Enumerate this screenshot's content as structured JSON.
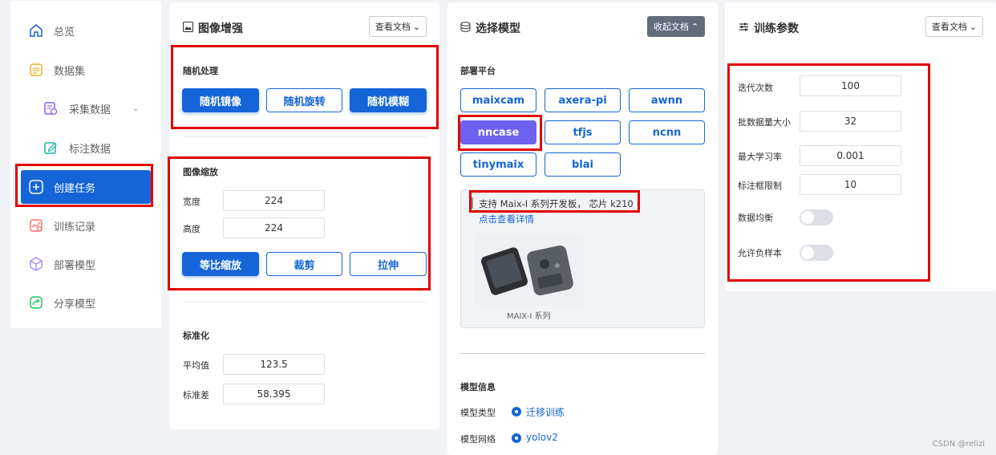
{
  "sidebar": {
    "items": [
      {
        "label": "总览",
        "icon": "home-icon"
      },
      {
        "label": "数据集",
        "icon": "dataset-icon"
      },
      {
        "label": "采集数据",
        "icon": "collect-icon"
      },
      {
        "label": "标注数据",
        "icon": "annotate-icon"
      },
      {
        "label": "创建任务",
        "icon": "plus-square-icon"
      },
      {
        "label": "训练记录",
        "icon": "train-record-icon"
      },
      {
        "label": "部署模型",
        "icon": "cube-icon"
      },
      {
        "label": "分享模型",
        "icon": "share-icon"
      }
    ]
  },
  "augment": {
    "title": "图像增强",
    "doc_button": "查看文档",
    "random_label": "随机处理",
    "random_buttons": [
      "随机镜像",
      "随机旋转",
      "随机模糊"
    ],
    "resize_label": "图像缩放",
    "width_label": "宽度",
    "width_value": "224",
    "height_label": "高度",
    "height_value": "224",
    "resize_buttons": [
      "等比缩放",
      "裁剪",
      "拉伸"
    ],
    "normalize_label": "标准化",
    "mean_label": "平均值",
    "mean_value": "123.5",
    "std_label": "标准差",
    "std_value": "58.395"
  },
  "model": {
    "title": "选择模型",
    "collapse_button": "收起文档",
    "platform_label": "部署平台",
    "platforms": [
      "maixcam",
      "axera-pi",
      "awnn",
      "nncase",
      "tfjs",
      "ncnn",
      "tinymaix",
      "blai"
    ],
    "selected_platform": "nncase",
    "info_text": "支持 Maix-I 系列开发板， 芯片 k210",
    "info_link": "点击查看详情",
    "board_caption": "MAIX-I 系列",
    "model_info_label": "模型信息",
    "model_type_label": "模型类型",
    "model_type_value": "迁移训练",
    "model_net_label": "模型网络",
    "model_net_value": "yolov2"
  },
  "train": {
    "title": "训练参数",
    "doc_button": "查看文档",
    "params": [
      {
        "label": "迭代次数",
        "value": "100"
      },
      {
        "label": "批数据量大小",
        "value": "32"
      },
      {
        "label": "最大学习率",
        "value": "0.001"
      },
      {
        "label": "标注框限制",
        "value": "10"
      }
    ],
    "balance_label": "数据均衡",
    "balance_on": false,
    "negative_label": "允许负样本",
    "negative_on": false
  },
  "watermark": "CSDN @relizi",
  "colors": {
    "primary": "#1565d8",
    "selected_platform": "#6b63f0",
    "highlight": "#e00000"
  }
}
